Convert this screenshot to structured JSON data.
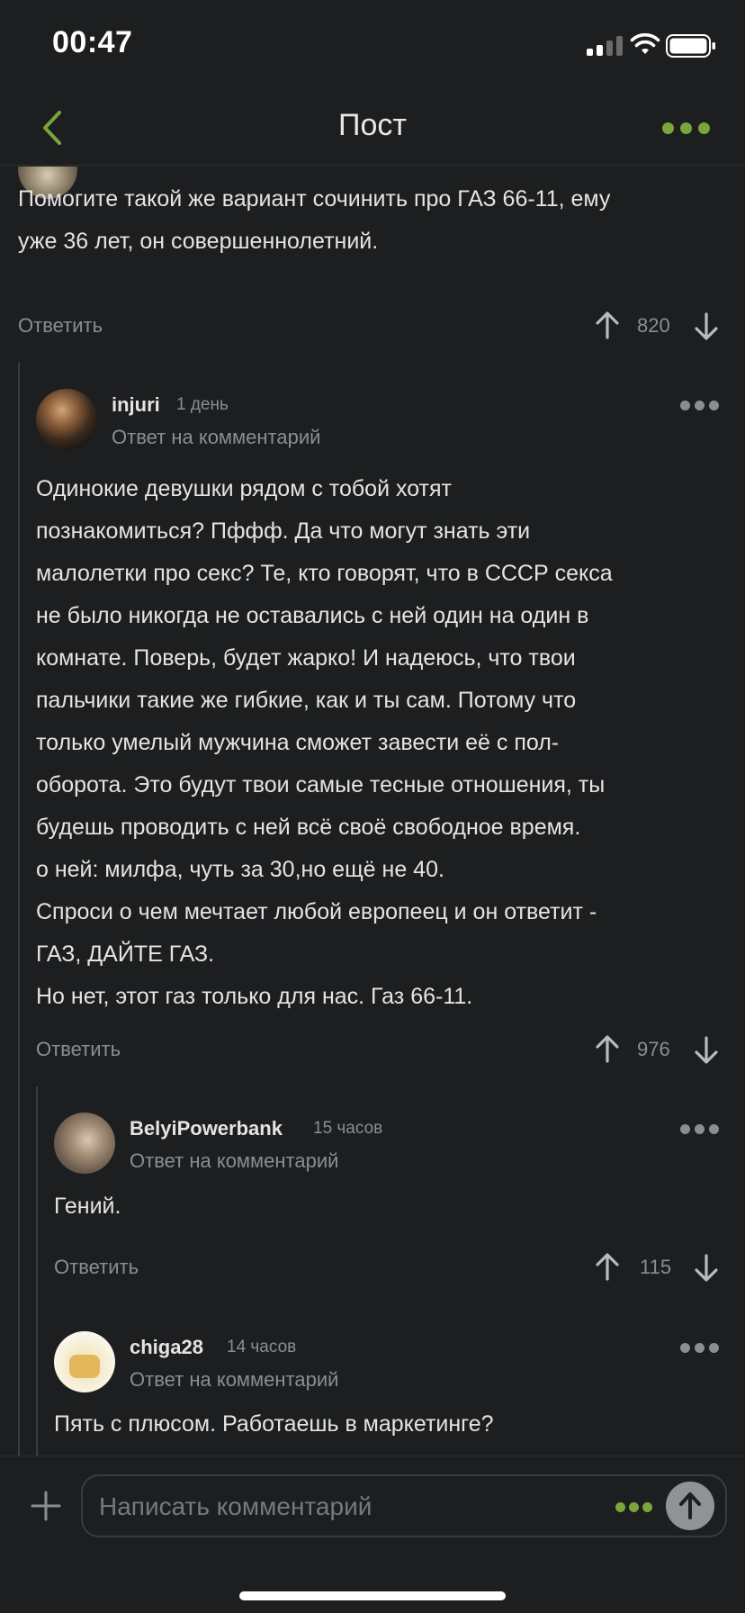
{
  "status_bar": {
    "time": "00:47"
  },
  "nav": {
    "title": "Пост",
    "back_icon": "chevron-left-icon",
    "more_icon": "more-dots-icon",
    "accent": "#7aa53c"
  },
  "top_comment": {
    "text_lines": [
      "Помогите такой же вариант сочинить про ГАЗ 66-11, ему",
      "уже 36 лет, он совершеннолетний."
    ],
    "reply_label": "Ответить",
    "rating": "820"
  },
  "comments": [
    {
      "username": "injuri",
      "time": "1 день",
      "reply_to": "Ответ на комментарий",
      "text_lines": [
        "Одинокие девушки рядом с тобой хотят",
        "познакомиться? Пффф. Да что могут знать эти",
        "малолетки про секс? Те, кто говорят, что в СССР секса",
        "не было никогда не оставались с ней один на один в",
        "комнате. Поверь, будет жарко! И надеюсь, что твои",
        "пальчики такие же гибкие, как и ты сам. Потому что",
        "только умелый мужчина сможет завести её с пол-",
        "оборота. Это будут твои самые тесные отношения, ты",
        "будешь проводить с ней всё своё свободное время.",
        "о ней: милфа, чуть за 30,но ещё не 40.",
        "Спроси о чем мечтает любой европеец и он ответит -",
        "ГАЗ, ДАЙТЕ ГАЗ.",
        "Но нет, этот газ только для нас. Газ 66-11."
      ],
      "reply_label": "Ответить",
      "rating": "976"
    },
    {
      "username": "BelyiPowerbank",
      "time": "15 часов",
      "reply_to": "Ответ на комментарий",
      "text_lines": [
        "Гений."
      ],
      "reply_label": "Ответить",
      "rating": "115"
    },
    {
      "username": "chiga28",
      "time": "14 часов",
      "reply_to": "Ответ на комментарий",
      "text_lines": [
        "Пять с плюсом. Работаешь в маркетинге?"
      ]
    }
  ],
  "composer": {
    "placeholder": "Написать комментарий"
  }
}
